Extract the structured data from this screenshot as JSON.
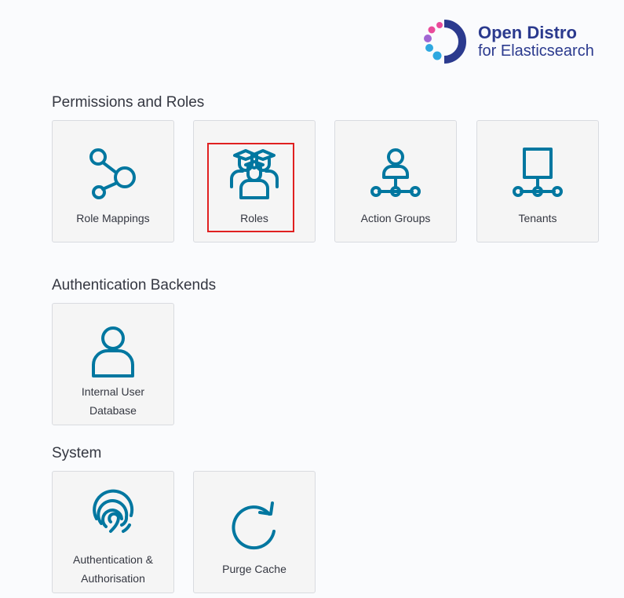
{
  "brand": {
    "line1": "Open Distro",
    "line2": "for Elasticsearch"
  },
  "sections": {
    "permissions": {
      "title": "Permissions and Roles",
      "tiles": [
        {
          "label": "Role Mappings",
          "icon": "role-mappings-icon"
        },
        {
          "label": "Roles",
          "icon": "roles-icon"
        },
        {
          "label": "Action Groups",
          "icon": "action-groups-icon"
        },
        {
          "label": "Tenants",
          "icon": "tenants-icon"
        }
      ]
    },
    "auth_backends": {
      "title": "Authentication Backends",
      "tiles": [
        {
          "label_line1": "Internal User",
          "label_line2": "Database",
          "icon": "user-icon"
        }
      ]
    },
    "system": {
      "title": "System",
      "tiles": [
        {
          "label_line1": "Authentication &",
          "label_line2": "Authorisation",
          "icon": "fingerprint-icon"
        },
        {
          "label": "Purge Cache",
          "icon": "refresh-icon"
        }
      ]
    }
  },
  "colors": {
    "accent": "#0077a0",
    "brand": "#2b3a8e",
    "highlight": "#e02020"
  }
}
